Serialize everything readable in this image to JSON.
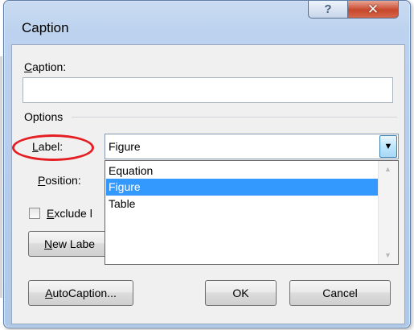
{
  "dialog": {
    "title": "Caption",
    "help_glyph": "?",
    "close_glyph": "✕"
  },
  "caption_field": {
    "label_mnemonic": "C",
    "label_rest": "aption:",
    "value": ""
  },
  "options_group": {
    "title": "Options"
  },
  "label_field": {
    "label_mnemonic": "L",
    "label_rest": "abel:",
    "value": "Figure",
    "highlight_color": "#e51e23"
  },
  "position_field": {
    "label_mnemonic": "P",
    "label_rest": "osition:"
  },
  "dropdown": {
    "options": [
      "Equation",
      "Figure",
      "Table"
    ],
    "selected_index": 1,
    "selected_color": "#3399ff"
  },
  "exclude_checkbox": {
    "label_mnemonic": "E",
    "label_rest": "xclude l",
    "checked": false
  },
  "buttons": {
    "new_label_mnemonic": "N",
    "new_label_rest": "ew Labe",
    "autocaption_mnemonic": "A",
    "autocaption_rest": "utoCaption...",
    "ok": "OK",
    "cancel": "Cancel"
  }
}
